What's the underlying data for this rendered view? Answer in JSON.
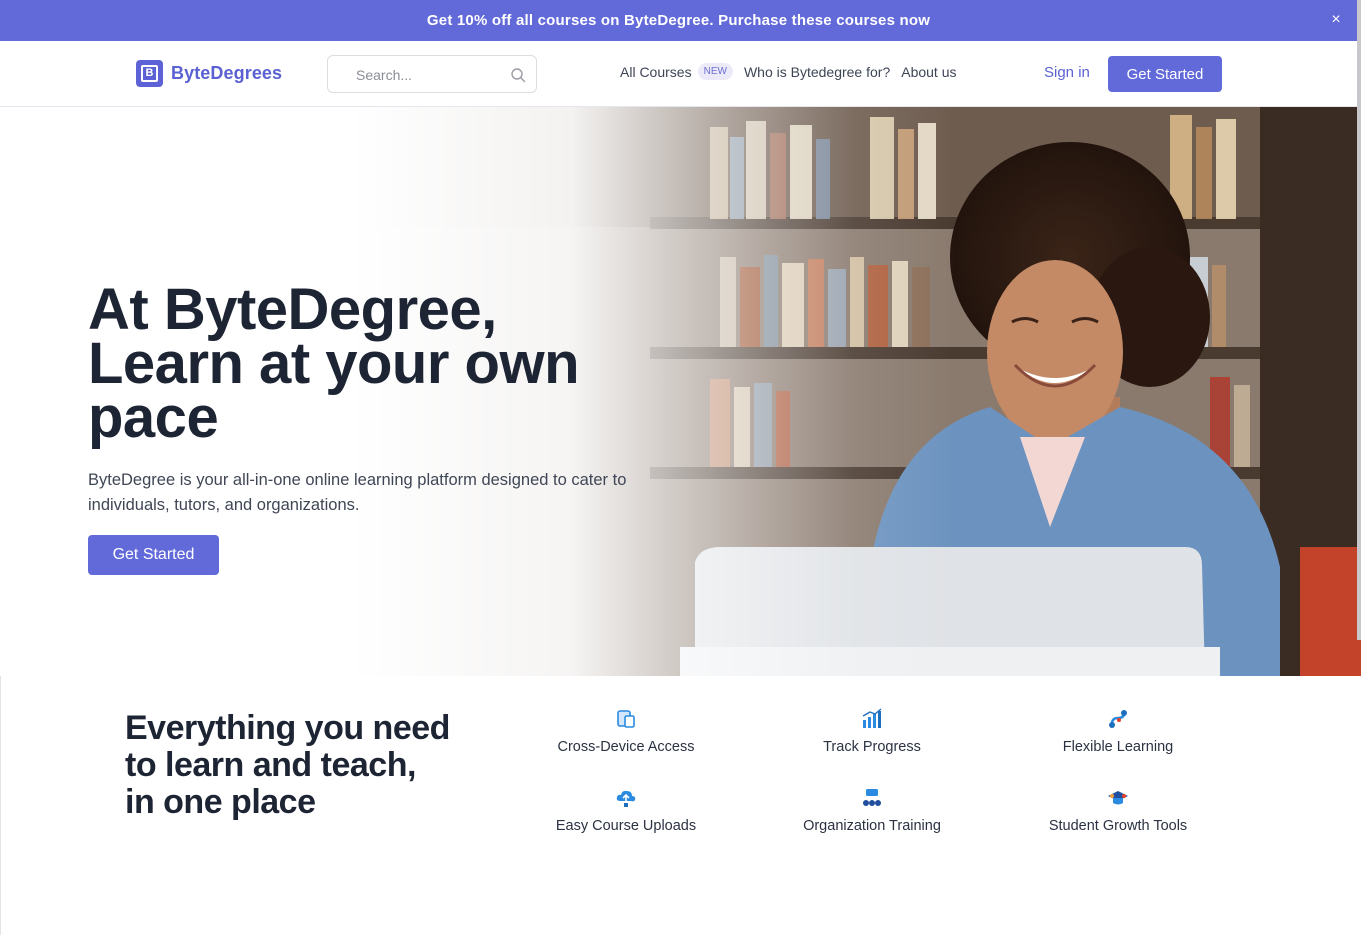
{
  "promo": {
    "text": "Get 10% off all courses on ByteDegree. Purchase these courses now",
    "close": "×"
  },
  "header": {
    "brand": {
      "logo_letter": "B",
      "name": "ByteDegrees"
    },
    "search": {
      "placeholder": "Search..."
    },
    "nav": {
      "all_courses": "All Courses",
      "new_badge": "NEW",
      "who_for": "Who is Bytedegree for?",
      "about": "About us"
    },
    "sign_in": "Sign in",
    "get_started": "Get Started"
  },
  "hero": {
    "title_line1": "At ByteDegree,",
    "title_line2": "Learn at your own",
    "title_line3": "pace",
    "subtitle": "ByteDegree is your all-in-one online learning platform designed to cater to individuals, tutors, and organizations.",
    "cta": "Get Started"
  },
  "features": {
    "title_line1": "Everything you need",
    "title_line2": "to learn and teach,",
    "title_line3": "in one place",
    "items": [
      {
        "label": "Cross-Device Access",
        "icon": "devices-icon"
      },
      {
        "label": "Track Progress",
        "icon": "bar-chart-icon"
      },
      {
        "label": "Flexible Learning",
        "icon": "flexible-link-icon"
      },
      {
        "label": "Easy Course Uploads",
        "icon": "cloud-upload-icon"
      },
      {
        "label": "Organization Training",
        "icon": "org-chart-icon"
      },
      {
        "label": "Student Growth Tools",
        "icon": "graduation-cap-icon"
      }
    ]
  },
  "colors": {
    "brand": "#6269d9",
    "heading": "#1d2433",
    "icon_blue": "#2a8be0"
  }
}
